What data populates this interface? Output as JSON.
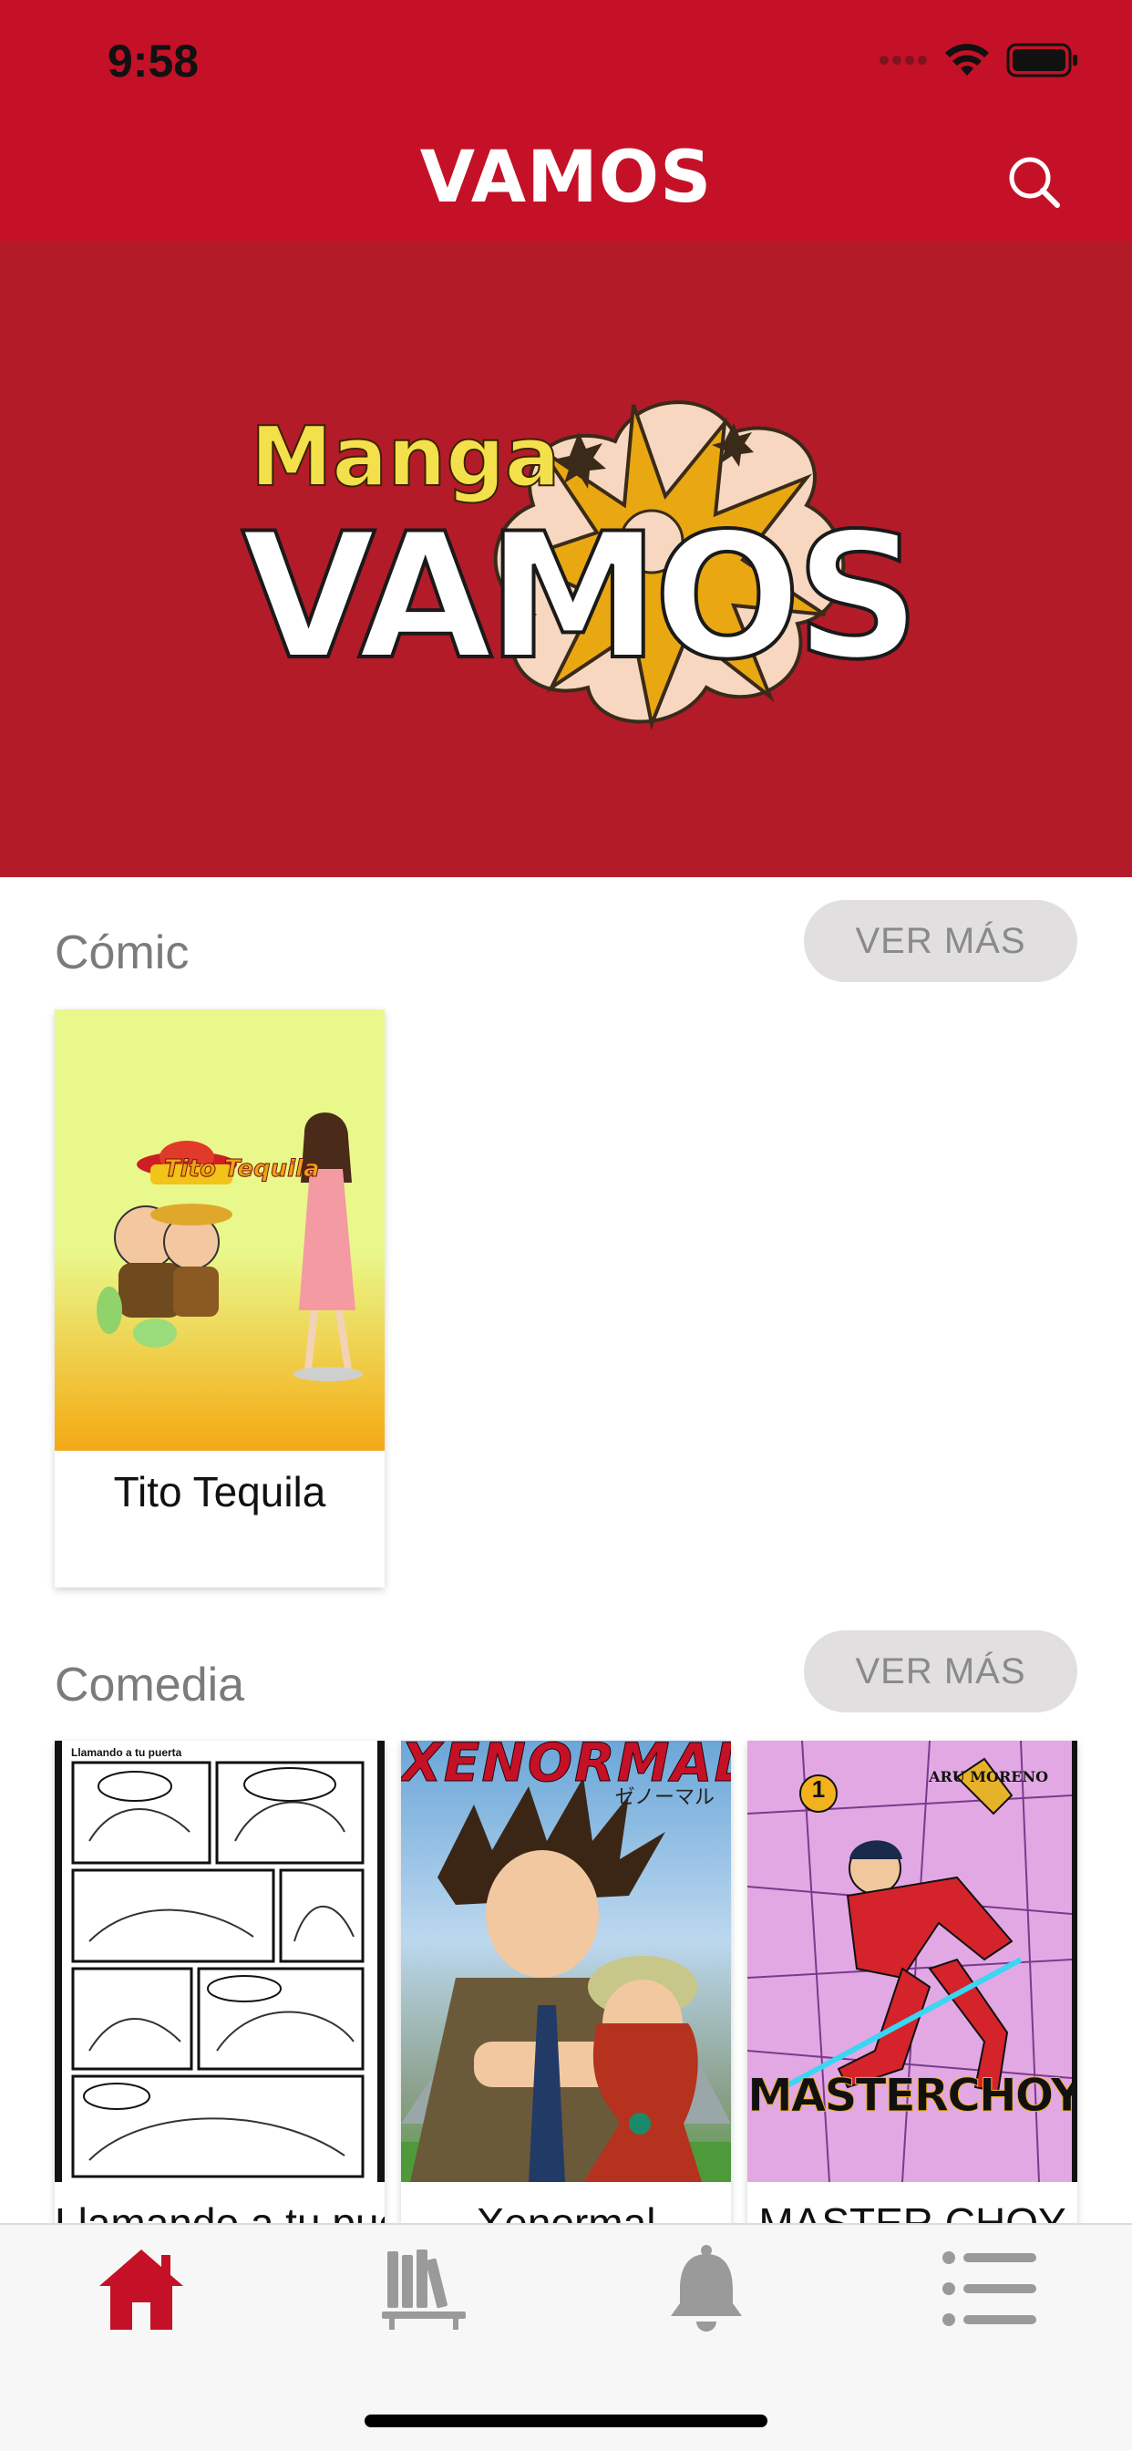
{
  "status_bar": {
    "time": "9:58",
    "icons": [
      "signal-icon",
      "wifi-icon",
      "battery-icon"
    ]
  },
  "nav": {
    "title": "VAMOS",
    "search_icon": "search-icon"
  },
  "banner": {
    "logo_manga": "Manga",
    "logo_vamos": "VAMOS"
  },
  "sections": [
    {
      "title": "Cómic",
      "more_label": "VER MÁS",
      "items": [
        {
          "title": "Tito Tequila",
          "cover_text": "Tito Tequila"
        }
      ]
    },
    {
      "title": "Comedia",
      "more_label": "VER MÁS",
      "items": [
        {
          "title": "Llamando a tu puerta",
          "cover_text": "Llamando a tu puerta"
        },
        {
          "title": "Xenormal",
          "cover_text": "XENORMAL",
          "cover_subtext": "ゼノーマル"
        },
        {
          "title": "MASTER CHOY",
          "cover_text": "MASTERCHOY",
          "cover_author": "ARU MORENO",
          "cover_number": "1"
        }
      ]
    }
  ],
  "tabbar": {
    "tabs": [
      {
        "name": "home",
        "icon": "home-icon",
        "active": true
      },
      {
        "name": "library",
        "icon": "library-icon",
        "active": false
      },
      {
        "name": "notifications",
        "icon": "bell-icon",
        "active": false
      },
      {
        "name": "list",
        "icon": "list-icon",
        "active": false
      }
    ]
  },
  "colors": {
    "brand_red": "#c41127",
    "banner_red": "#b31b29",
    "button_gray": "#e1dfdf",
    "inactive_icon": "#9a9a9a"
  }
}
